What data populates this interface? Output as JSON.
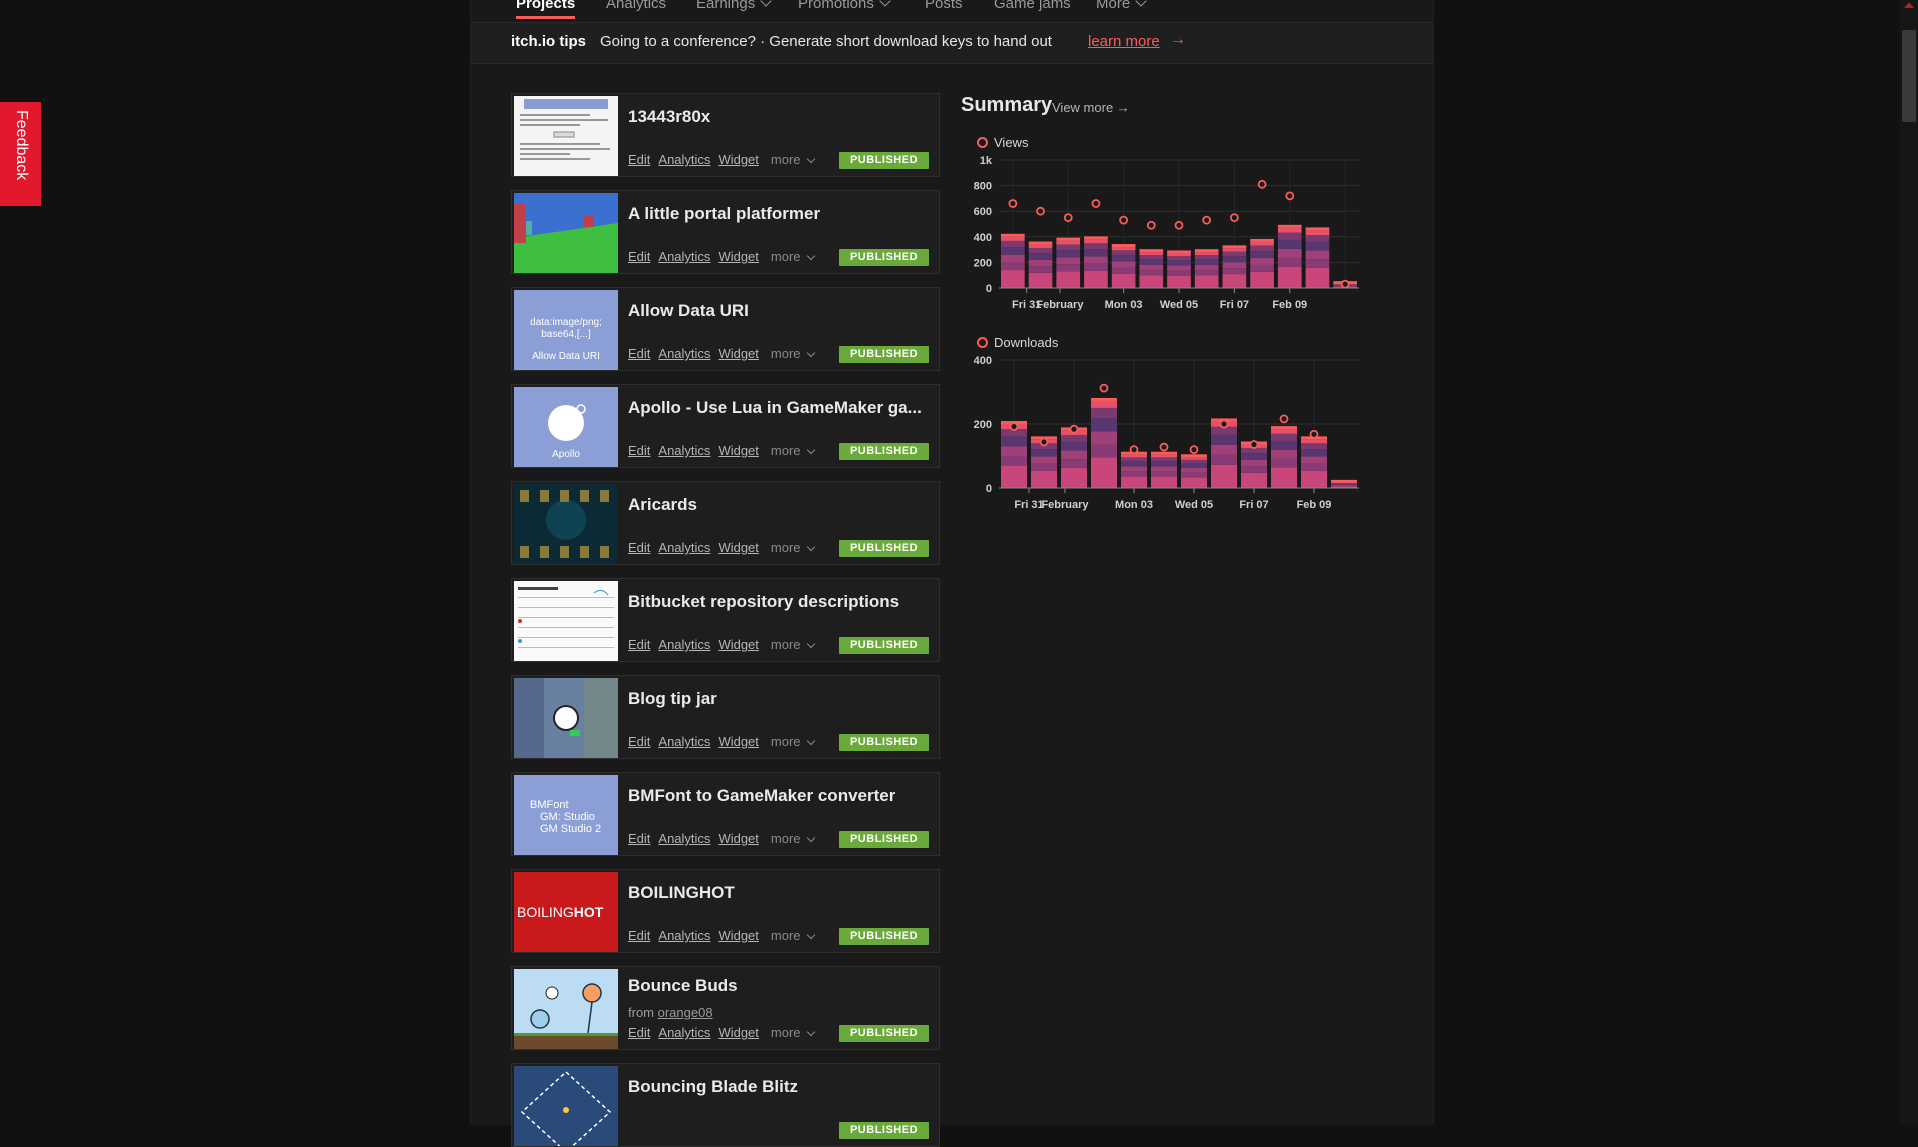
{
  "nav": {
    "items": [
      {
        "label": "Projects",
        "active": true
      },
      {
        "label": "Analytics"
      },
      {
        "label": "Earnings",
        "dropdown": true
      },
      {
        "label": "Promotions",
        "dropdown": true
      },
      {
        "label": "Posts"
      },
      {
        "label": "Game jams"
      },
      {
        "label": "More",
        "dropdown": true
      }
    ]
  },
  "tips": {
    "label": "itch.io tips",
    "text": "Going to a conference? · Generate short download keys to hand out",
    "link": "learn more",
    "arrow": "→"
  },
  "project_actions": {
    "edit": "Edit",
    "analytics": "Analytics",
    "widget": "Widget",
    "more": "more"
  },
  "projects": [
    {
      "title": "13443r80x",
      "status": "PUBLISHED"
    },
    {
      "title": "A little portal platformer",
      "status": "PUBLISHED"
    },
    {
      "title": "Allow Data URI",
      "status": "PUBLISHED",
      "thumb_text": [
        "data:image/png;",
        "base64,[...]",
        "Allow Data URI"
      ]
    },
    {
      "title": "Apollo - Use Lua in GameMaker ga...",
      "status": "PUBLISHED",
      "thumb_text": [
        "Apollo"
      ]
    },
    {
      "title": "Aricards",
      "status": "PUBLISHED"
    },
    {
      "title": "Bitbucket repository descriptions",
      "status": "PUBLISHED"
    },
    {
      "title": "Blog tip jar",
      "status": "PUBLISHED"
    },
    {
      "title": "BMFont to GameMaker converter",
      "status": "PUBLISHED",
      "thumb_text": [
        "BMFont",
        "GM: Studio",
        "GM Studio 2"
      ]
    },
    {
      "title": "BOILINGHOT",
      "status": "PUBLISHED",
      "thumb_text": [
        "BOILING",
        "HOT"
      ]
    },
    {
      "title": "Bounce Buds",
      "status": "PUBLISHED",
      "from_label": "from",
      "from_user": "orange08"
    },
    {
      "title": "Bouncing Blade Blitz",
      "status": "PUBLISHED"
    }
  ],
  "summary": {
    "title": "Summary",
    "view_more": "View more →"
  },
  "chart_data": [
    {
      "type": "bar",
      "title": "Views",
      "x_tick_labels": [
        "Fri 31",
        "February",
        "Mon 03",
        "Wed 05",
        "Fri 07",
        "Feb 09"
      ],
      "y_tick_labels": [
        "0",
        "200",
        "400",
        "600",
        "800",
        "1k"
      ],
      "ylim": [
        0,
        1000
      ],
      "values": [
        400,
        340,
        370,
        380,
        320,
        280,
        270,
        280,
        310,
        360,
        470,
        450,
        30
      ],
      "line_values": [
        660,
        600,
        550,
        660,
        530,
        490,
        490,
        530,
        550,
        810,
        720,
        30
      ],
      "colors": {
        "accent": "#fa5c5c",
        "stack_dark": "#6a3a6a",
        "stack_light": "#c0426b"
      }
    },
    {
      "type": "bar",
      "title": "Downloads",
      "x_tick_labels": [
        "Fri 31",
        "February",
        "Mon 03",
        "Wed 05",
        "Fri 07",
        "Feb 09"
      ],
      "y_tick_labels": [
        "0",
        "200",
        "400"
      ],
      "ylim": [
        0,
        500
      ],
      "values": [
        250,
        190,
        225,
        340,
        130,
        130,
        120,
        260,
        170,
        230,
        190,
        20
      ],
      "line_values": [
        240,
        180,
        230,
        390,
        150,
        160,
        150,
        250,
        170,
        270,
        210,
        10
      ],
      "colors": {
        "accent": "#fa5c5c",
        "stack_dark": "#6a3a6a",
        "stack_light": "#c0426b"
      }
    }
  ],
  "feedback": {
    "label": "Feedback"
  }
}
